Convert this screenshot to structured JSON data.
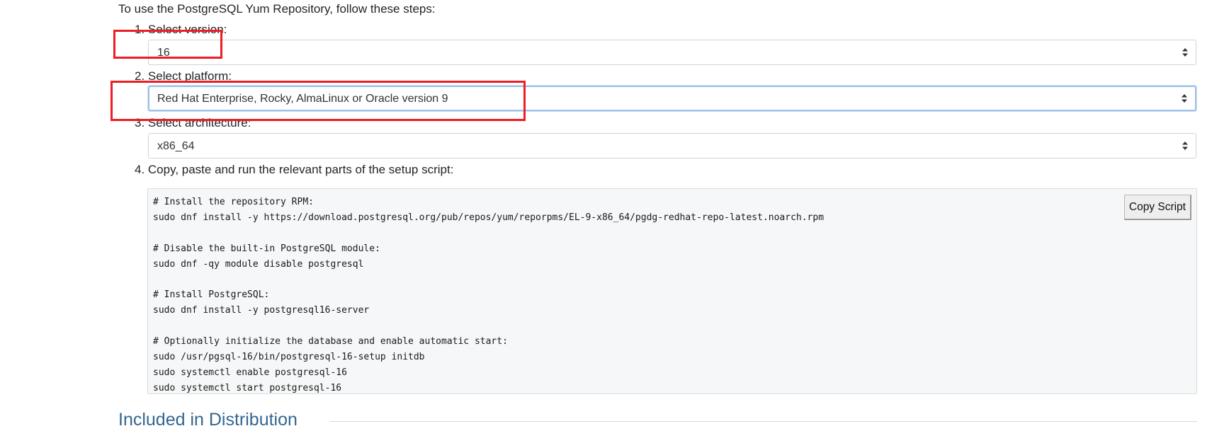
{
  "intro": "To use the PostgreSQL Yum Repository, follow these steps:",
  "steps": {
    "version_label": "1. Select version:",
    "version_value": "16",
    "platform_label": "2. Select platform:",
    "platform_value": "Red Hat Enterprise, Rocky, AlmaLinux or Oracle version 9",
    "arch_label": "3. Select architecture:",
    "arch_value": "x86_64",
    "script_label": "4. Copy, paste and run the relevant parts of the setup script:"
  },
  "script": {
    "copy_button": "Copy Script",
    "lines": [
      "# Install the repository RPM:",
      "sudo dnf install -y https://download.postgresql.org/pub/repos/yum/reporpms/EL-9-x86_64/pgdg-redhat-repo-latest.noarch.rpm",
      "",
      "# Disable the built-in PostgreSQL module:",
      "sudo dnf -qy module disable postgresql",
      "",
      "# Install PostgreSQL:",
      "sudo dnf install -y postgresql16-server",
      "",
      "# Optionally initialize the database and enable automatic start:",
      "sudo /usr/pgsql-16/bin/postgresql-16-setup initdb",
      "sudo systemctl enable postgresql-16",
      "sudo systemctl start postgresql-16"
    ]
  },
  "section_heading": "Included in Distribution",
  "colors": {
    "heading": "#336791",
    "annotation": "#ee1c24",
    "focus_border": "#9ec0ea"
  },
  "icons": {
    "select_arrow": "select-arrows-icon"
  }
}
